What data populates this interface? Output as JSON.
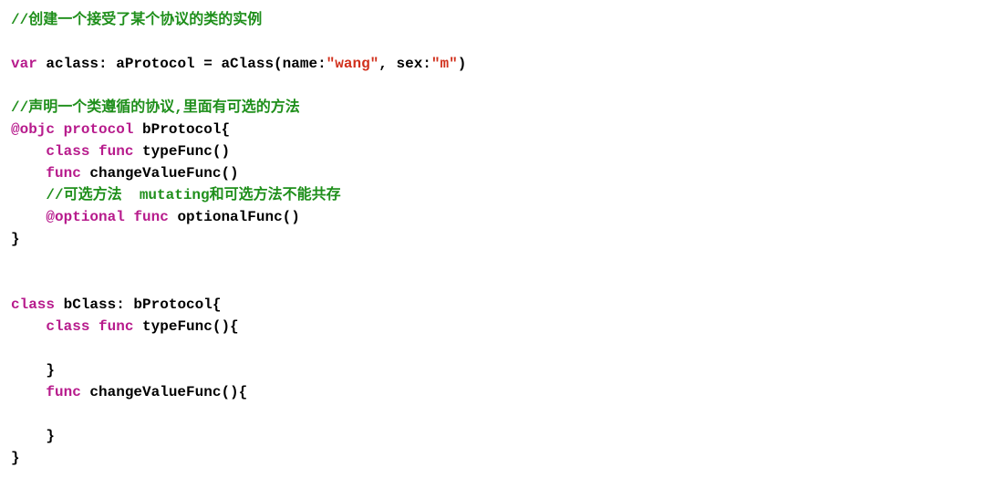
{
  "lines": {
    "c1": "//创建一个接受了某个协议的类的实例",
    "blank1": "",
    "l2_a": "var",
    "l2_b": " aclass: aProtocol = aClass(name:",
    "l2_c": "\"wang\"",
    "l2_d": ", sex:",
    "l2_e": "\"m\"",
    "l2_f": ")",
    "blank2": "",
    "c2": "//声明一个类遵循的协议,里面有可选的方法",
    "l4_a": "@objc",
    "l4_b": " ",
    "l4_c": "protocol",
    "l4_d": " bProtocol{",
    "l5_a": "    ",
    "l5_b": "class",
    "l5_c": " ",
    "l5_d": "func",
    "l5_e": " typeFunc()",
    "l6_a": "    ",
    "l6_b": "func",
    "l6_c": " changeValueFunc()",
    "c3_a": "    ",
    "c3_b": "//可选方法  mutating和可选方法不能共存",
    "l8_a": "    ",
    "l8_b": "@optional",
    "l8_c": " ",
    "l8_d": "func",
    "l8_e": " optionalFunc()",
    "l9": "}",
    "blank3": "",
    "blank4": "",
    "l10_a": "class",
    "l10_b": " bClass: bProtocol{",
    "l11_a": "    ",
    "l11_b": "class",
    "l11_c": " ",
    "l11_d": "func",
    "l11_e": " typeFunc(){",
    "l12": "        ",
    "l13": "    }",
    "l14_a": "    ",
    "l14_b": "func",
    "l14_c": " changeValueFunc(){",
    "l15": "        ",
    "l16": "    }",
    "l17": "}"
  }
}
